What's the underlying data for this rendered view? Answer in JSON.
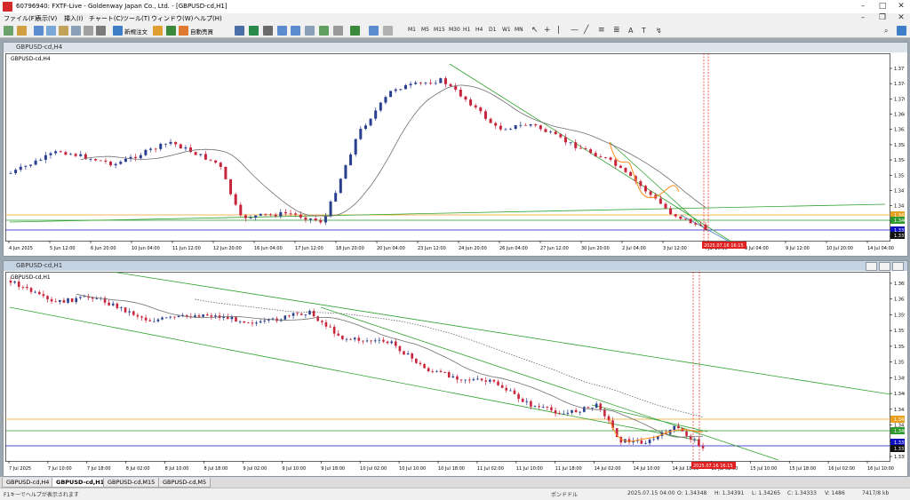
{
  "window": {
    "title": "60796940: FXTF-Live - Goldenway Japan Co., Ltd. - [GBPUSD-cd,H1]"
  },
  "menu": [
    "ファイル(F)",
    "表示(V)",
    "挿入(I)",
    "チャート(C)",
    "ツール(T)",
    "ウィンドウ(W)",
    "ヘルプ(H)"
  ],
  "toolbar": {
    "new_order": "新規注文",
    "auto_trade": "自動売買",
    "timeframes": [
      "M1",
      "M5",
      "M15",
      "M30",
      "H1",
      "H4",
      "D1",
      "W1",
      "MN"
    ]
  },
  "chart_h4": {
    "title": "GBPUSD-cd,H4",
    "label": "GBPUSD-cd,H4",
    "price_ticks": [
      "1.37780",
      "1.37400",
      "1.37010",
      "1.36630",
      "1.36250",
      "1.35870",
      "1.35480",
      "1.35100",
      "1.34720",
      "1.34330",
      "1.33950",
      "1.33570"
    ],
    "price_tags": [
      {
        "value": "1.34251",
        "color": "#e8a020"
      },
      {
        "value": "1.34018",
        "color": "#2e9a2e"
      },
      {
        "value": "1.33798",
        "color": "#1010c0"
      },
      {
        "value": "1.33717",
        "color": "#111111"
      }
    ],
    "time_ticks": [
      "4 Jun 2025",
      "5 Jun 12:00",
      "6 Jun 20:00",
      "10 Jun 04:00",
      "11 Jun 12:00",
      "12 Jun 20:00",
      "16 Jun 04:00",
      "17 Jun 12:00",
      "18 Jun 20:00",
      "20 Jun 04:00",
      "23 Jun 12:00",
      "24 Jun 20:00",
      "26 Jun 04:00",
      "27 Jun 12:00",
      "30 Jun 20:00",
      "2 Jul 04:00",
      "3 Jul 12:00",
      "4 Jul 20:00",
      "8 Jul 04:00",
      "9 Jul 12:00",
      "10 Jul 20:00",
      "14 Jul 04:00"
    ],
    "time_marker": "2025.07.16 16:15"
  },
  "chart_h1": {
    "title": "GBPUSD-cd,H1",
    "label": "GBPUSD-cd,H1",
    "price_ticks": [
      "1.36500",
      "1.36235",
      "1.35970",
      "1.35705",
      "1.35440",
      "1.35175",
      "1.34910",
      "1.34645",
      "1.34380",
      "1.34120",
      "1.33855",
      "1.33590"
    ],
    "price_tags": [
      {
        "value": "1.34251",
        "color": "#e8a020"
      },
      {
        "value": "1.34018",
        "color": "#2e9a2e"
      },
      {
        "value": "1.33798",
        "color": "#1010c0"
      },
      {
        "value": "1.33717",
        "color": "#111111"
      }
    ],
    "time_ticks": [
      "7 Jul 2025",
      "7 Jul 10:00",
      "7 Jul 18:00",
      "8 Jul 02:00",
      "8 Jul 10:00",
      "8 Jul 18:00",
      "9 Jul 02:00",
      "9 Jul 10:00",
      "9 Jul 18:00",
      "10 Jul 02:00",
      "10 Jul 10:00",
      "10 Jul 18:00",
      "11 Jul 02:00",
      "11 Jul 10:00",
      "11 Jul 18:00",
      "14 Jul 02:00",
      "14 Jul 10:00",
      "14 Jul 18:00",
      "15 Jul 02:00",
      "15 Jul 10:00",
      "15 Jul 18:00",
      "16 Jul 02:00",
      "16 Jul 10:00"
    ],
    "time_marker": "2025.07.16 16:15"
  },
  "tabs": [
    "GBPUSD-cd,H4",
    "GBPUSD-cd,H1",
    "GBPUSD-cd,M15",
    "GBPUSD-cd,M5"
  ],
  "status": {
    "help": "F1キーでヘルプが表示されます",
    "profile": "ポンドドル",
    "datetime": "2025.07.15 04:00",
    "open": "O: 1.34348",
    "high": "H: 1.34391",
    "low": "L: 1.34265",
    "close": "C: 1.34333",
    "volume": "V: 1486",
    "traffic": "7417/8 kb"
  },
  "colors": {
    "bull": "#2a3f8f",
    "bear": "#c8253c",
    "ma": "#6e6e6e",
    "trend": "#2ea32e",
    "orange": "#ff8c1a",
    "marker": "#e02020"
  }
}
